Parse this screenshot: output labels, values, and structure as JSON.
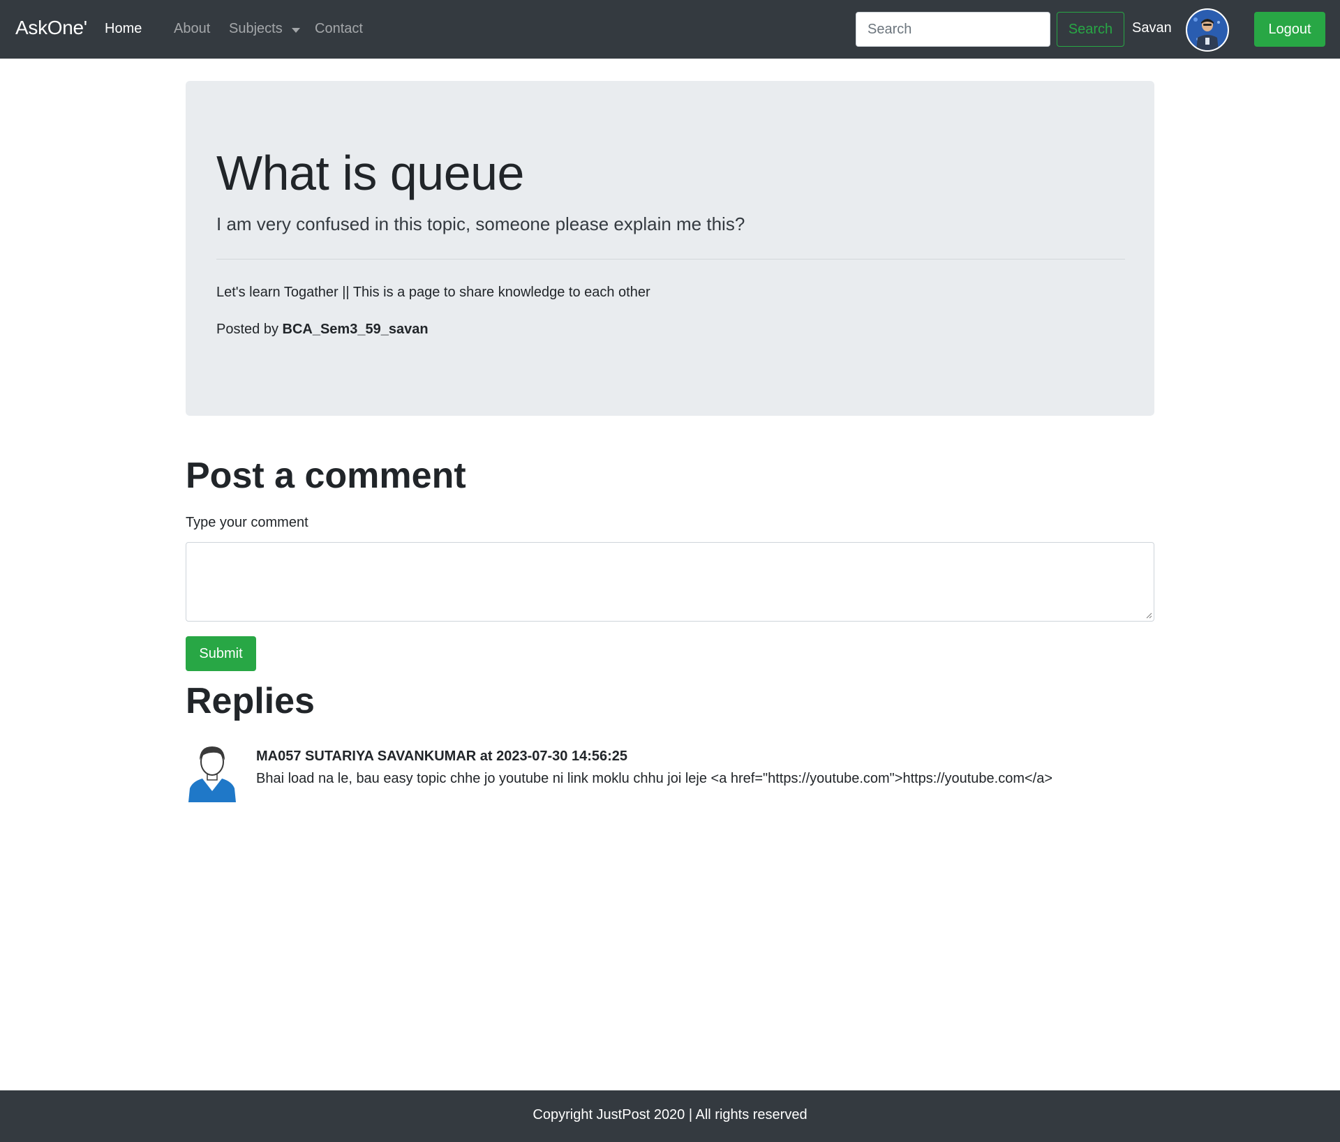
{
  "navbar": {
    "brand": "AskOne'",
    "links": [
      {
        "label": "Home"
      },
      {
        "label": "About"
      },
      {
        "label": "Subjects"
      },
      {
        "label": "Contact"
      }
    ],
    "search_placeholder": "Search",
    "search_button": "Search",
    "username": "Savan",
    "logout_label": "Logout",
    "avatar_icon": "user-photo-icon"
  },
  "thread": {
    "title": "What is queue",
    "description": "I am very confused in this topic, someone please explain me this?",
    "tagline": "Let's learn Togather || This is a page to share knowledge to each other",
    "posted_by_prefix": "Posted by ",
    "posted_by_user": "BCA_Sem3_59_savan"
  },
  "comment_form": {
    "heading": "Post a comment",
    "label": "Type your comment",
    "value": "",
    "submit_label": "Submit"
  },
  "replies": {
    "heading": "Replies",
    "items": [
      {
        "header": "MA057 SUTARIYA SAVANKUMAR at 2023-07-30 14:56:25",
        "body": "Bhai load na le, bau easy topic chhe jo youtube ni link moklu chhu joi leje <a href=\"https://youtube.com\">https://youtube.com</a>",
        "avatar_icon": "default-user-icon"
      }
    ]
  },
  "footer": {
    "text": "Copyright JustPost 2020 | All rights reserved"
  },
  "colors": {
    "navbar_bg": "#343a40",
    "jumbotron_bg": "#e9ecef",
    "success": "#28a745",
    "text": "#212529"
  }
}
